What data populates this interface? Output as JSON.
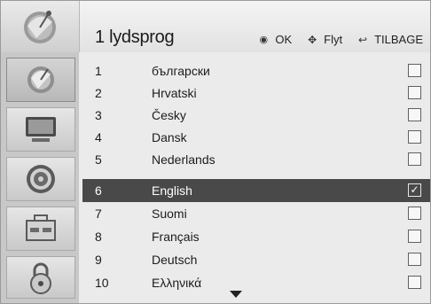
{
  "header": {
    "title": "1 lydsprog",
    "hints": [
      {
        "icon": "ok-button-icon",
        "glyph": "◉",
        "label": "OK"
      },
      {
        "icon": "move-arrows-icon",
        "glyph": "✥",
        "label": "Flyt"
      },
      {
        "icon": "back-arrow-icon",
        "glyph": "↩",
        "label": "TILBAGE"
      }
    ]
  },
  "sidebar": {
    "items": [
      {
        "name": "satellite",
        "icon": "satellite-dish-icon",
        "active": true
      },
      {
        "name": "picture",
        "icon": "tv-screen-icon",
        "active": false
      },
      {
        "name": "sound",
        "icon": "speaker-icon",
        "active": false
      },
      {
        "name": "time",
        "icon": "toolbox-icon",
        "active": false
      },
      {
        "name": "lock",
        "icon": "padlock-icon",
        "active": false
      }
    ]
  },
  "languages": [
    {
      "num": "1",
      "name": "български",
      "checked": false
    },
    {
      "num": "2",
      "name": "Hrvatski",
      "checked": false
    },
    {
      "num": "3",
      "name": "Česky",
      "checked": false
    },
    {
      "num": "4",
      "name": "Dansk",
      "checked": false
    },
    {
      "num": "5",
      "name": "Nederlands",
      "checked": false
    },
    {
      "num": "6",
      "name": "English",
      "checked": true,
      "selected": true
    },
    {
      "num": "7",
      "name": "Suomi",
      "checked": false
    },
    {
      "num": "8",
      "name": "Français",
      "checked": false
    },
    {
      "num": "9",
      "name": "Deutsch",
      "checked": false
    },
    {
      "num": "10",
      "name": "Ελληνικά",
      "checked": false
    }
  ],
  "checkmark": "✓",
  "colors": {
    "selected_row": "#494949",
    "background": "#ebebeb",
    "sidebar": "#c8c8c8"
  }
}
